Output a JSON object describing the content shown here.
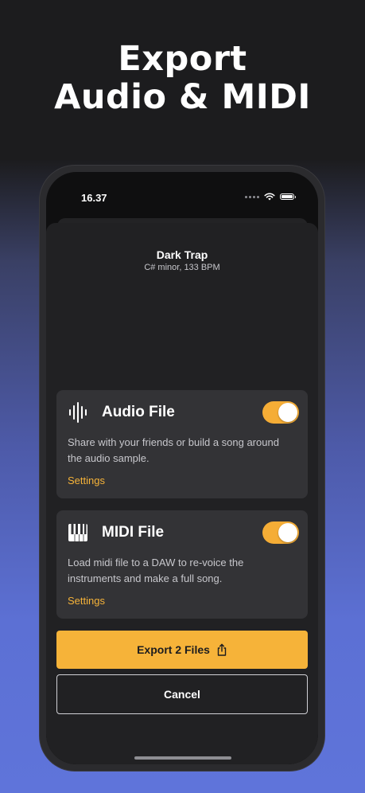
{
  "headline": {
    "line1": "Export",
    "line2": "Audio & MIDI"
  },
  "status_bar": {
    "time": "16.37"
  },
  "song": {
    "title": "Dark Trap",
    "details": "C# minor, 133 BPM"
  },
  "audio_option": {
    "title": "Audio File",
    "description": "Share with your friends or build a song around the audio sample.",
    "settings_label": "Settings",
    "enabled": true
  },
  "midi_option": {
    "title": "MIDI File",
    "description": "Load midi file to a DAW to re-voice the instruments and make a full song.",
    "settings_label": "Settings",
    "enabled": true
  },
  "actions": {
    "export_label": "Export 2 Files",
    "cancel_label": "Cancel"
  },
  "colors": {
    "accent": "#f6b339",
    "card": "#333336",
    "sheet": "#212123"
  }
}
